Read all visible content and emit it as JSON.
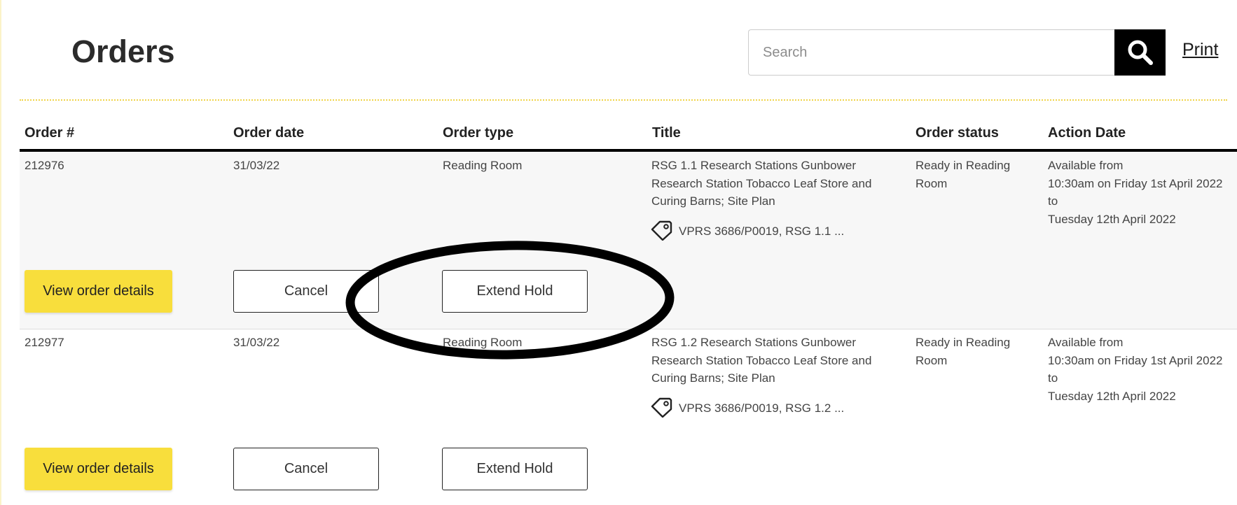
{
  "page": {
    "title": "Orders"
  },
  "search": {
    "placeholder": "Search",
    "value": ""
  },
  "toolbar": {
    "print_label": "Print"
  },
  "table": {
    "columns": [
      "Order #",
      "Order date",
      "Order type",
      "Title",
      "Order status",
      "Action Date"
    ],
    "rows": [
      {
        "order_number": "212976",
        "order_date": "31/03/22",
        "order_type": "Reading Room",
        "title": "RSG 1.1 Research Stations Gunbower Research Station Tobacco Leaf Store and Curing Barns; Site Plan",
        "reference": "VPRS 3686/P0019, RSG 1.1 ...",
        "status": "Ready in Reading Room",
        "action_date": {
          "line1": "Available from",
          "line2": "10:30am on Friday 1st April 2022",
          "line3": "to",
          "line4": "Tuesday 12th April 2022"
        },
        "buttons": {
          "view": "View order details",
          "cancel": "Cancel",
          "extend": "Extend Hold"
        }
      },
      {
        "order_number": "212977",
        "order_date": "31/03/22",
        "order_type": "Reading Room",
        "title": "RSG 1.2 Research Stations Gunbower Research Station Tobacco Leaf Store and Curing Barns; Site Plan",
        "reference": "VPRS 3686/P0019, RSG 1.2 ...",
        "status": "Ready in Reading Room",
        "action_date": {
          "line1": "Available from",
          "line2": "10:30am on Friday 1st April 2022",
          "line3": "to",
          "line4": "Tuesday 12th April 2022"
        },
        "buttons": {
          "view": "View order details",
          "cancel": "Cancel",
          "extend": "Extend Hold"
        }
      }
    ]
  },
  "icons": {
    "search": "search-icon",
    "tag": "tag-icon"
  },
  "colors": {
    "accent": "#f8de3c",
    "annotation": "#000000"
  }
}
